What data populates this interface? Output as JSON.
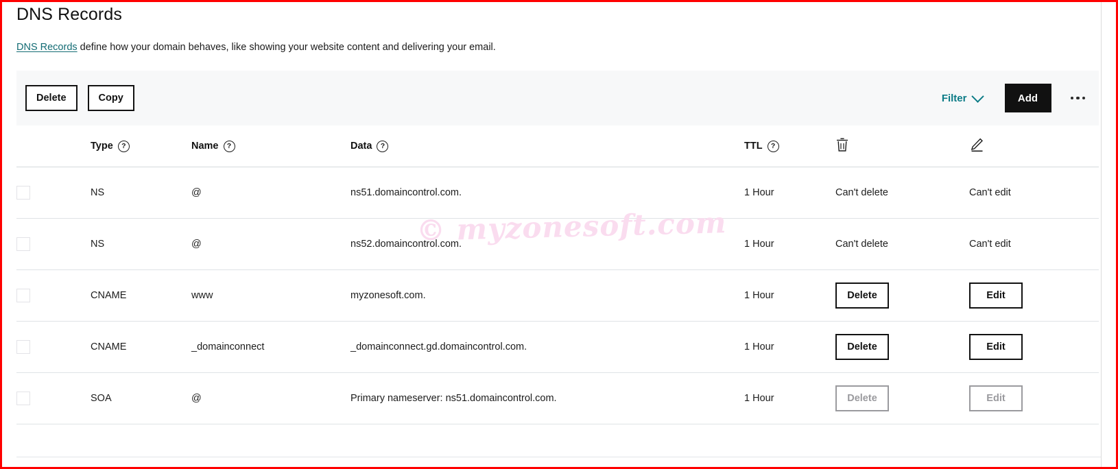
{
  "page": {
    "title": "DNS Records",
    "description_link": "DNS Records",
    "description_rest": " define how your domain behaves, like showing your website content and delivering your email."
  },
  "watermark": {
    "text": "© myzonesoft.com",
    "color": "#fadcef"
  },
  "colors": {
    "accent_teal": "#0b7b86",
    "link_teal": "#126b73",
    "add_button_bg": "#111111",
    "toolbar_bg": "#f7f8f9",
    "border_red": "#ff0000",
    "muted_text": "#8e8e93"
  },
  "toolbar": {
    "delete_label": "Delete",
    "copy_label": "Copy",
    "filter_label": "Filter",
    "filter_chevron_icon": "chevron-down-icon",
    "add_label": "Add",
    "more_icon": "ellipsis-icon"
  },
  "table": {
    "columns": [
      {
        "key": "checkbox",
        "label": "",
        "icon": ""
      },
      {
        "key": "type",
        "label": "Type",
        "icon": "help-circle-icon"
      },
      {
        "key": "name",
        "label": "Name",
        "icon": "help-circle-icon"
      },
      {
        "key": "data",
        "label": "Data",
        "icon": "help-circle-icon"
      },
      {
        "key": "ttl",
        "label": "TTL",
        "icon": "help-circle-icon"
      },
      {
        "key": "delete",
        "label": "",
        "icon": "trash-icon"
      },
      {
        "key": "edit",
        "label": "",
        "icon": "pencil-icon"
      }
    ],
    "rows": [
      {
        "type": "NS",
        "name": "@",
        "data": "ns51.domaincontrol.com.",
        "ttl": "1 Hour",
        "delete": {
          "kind": "text",
          "label": "Can't delete"
        },
        "edit": {
          "kind": "text",
          "label": "Can't edit"
        }
      },
      {
        "type": "NS",
        "name": "@",
        "data": "ns52.domaincontrol.com.",
        "ttl": "1 Hour",
        "delete": {
          "kind": "text",
          "label": "Can't delete"
        },
        "edit": {
          "kind": "text",
          "label": "Can't edit"
        }
      },
      {
        "type": "CNAME",
        "name": "www",
        "data": "myzonesoft.com.",
        "ttl": "1 Hour",
        "delete": {
          "kind": "button",
          "label": "Delete",
          "state": "enabled"
        },
        "edit": {
          "kind": "button",
          "label": "Edit",
          "state": "enabled"
        }
      },
      {
        "type": "CNAME",
        "name": "_domainconnect",
        "data": "_domainconnect.gd.domaincontrol.com.",
        "ttl": "1 Hour",
        "delete": {
          "kind": "button",
          "label": "Delete",
          "state": "enabled"
        },
        "edit": {
          "kind": "button",
          "label": "Edit",
          "state": "enabled"
        }
      },
      {
        "type": "SOA",
        "name": "@",
        "data": "Primary nameserver: ns51.domaincontrol.com.",
        "ttl": "1 Hour",
        "delete": {
          "kind": "button",
          "label": "Delete",
          "state": "disabled"
        },
        "edit": {
          "kind": "button",
          "label": "Edit",
          "state": "disabled"
        }
      }
    ]
  }
}
